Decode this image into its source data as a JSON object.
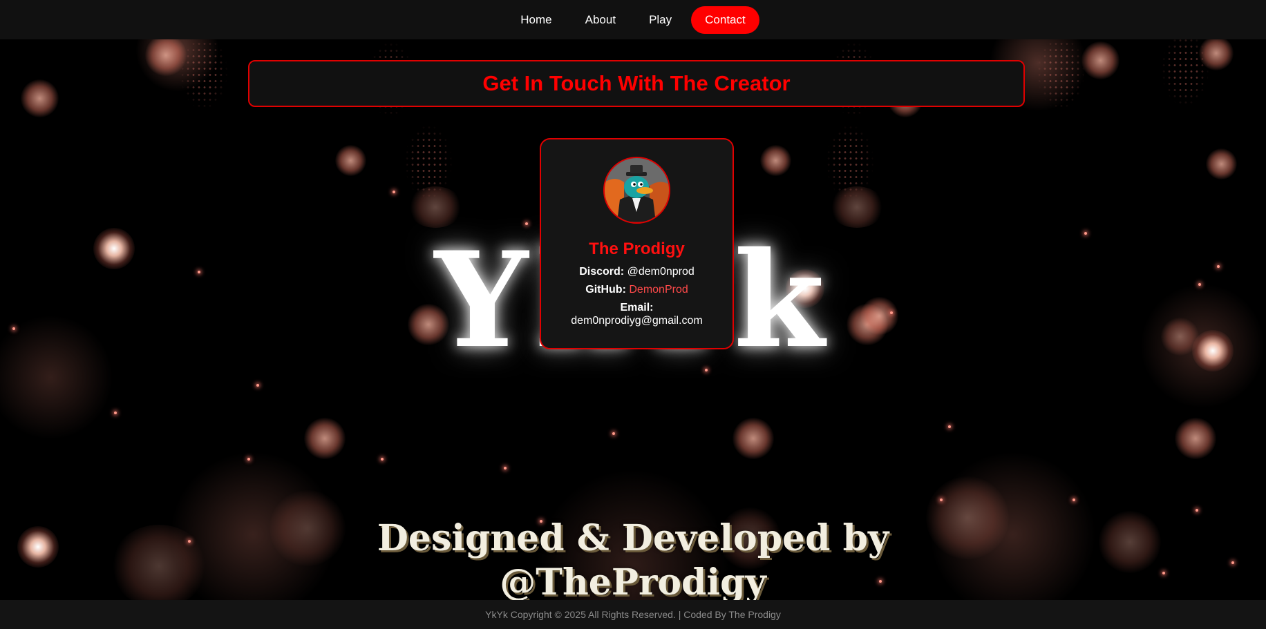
{
  "navbar": {
    "items": [
      {
        "label": "Home",
        "active": false
      },
      {
        "label": "About",
        "active": false
      },
      {
        "label": "Play",
        "active": false
      },
      {
        "label": "Contact",
        "active": true
      }
    ]
  },
  "background": {
    "word": "YkYk"
  },
  "banner": {
    "title": "Get In Touch With The Creator"
  },
  "card": {
    "name": "The Prodigy",
    "discord_label": "Discord:",
    "discord_value": "@dem0nprod",
    "github_label": "GitHub:",
    "github_value": "DemonProd",
    "email_label": "Email:",
    "email_value": "dem0nprodiyg@gmail.com",
    "avatar_icon": "platypus-agent-avatar"
  },
  "designed": {
    "line1": "Designed & Developed by",
    "line2": "@TheProdigy"
  },
  "footer": {
    "text": "YkYk Copyright © 2025 All Rights Reserved. | Coded By The Prodigy"
  },
  "colors": {
    "accent": "#ff0000",
    "navbar_bg": "#111111",
    "card_bg": "#151515"
  }
}
